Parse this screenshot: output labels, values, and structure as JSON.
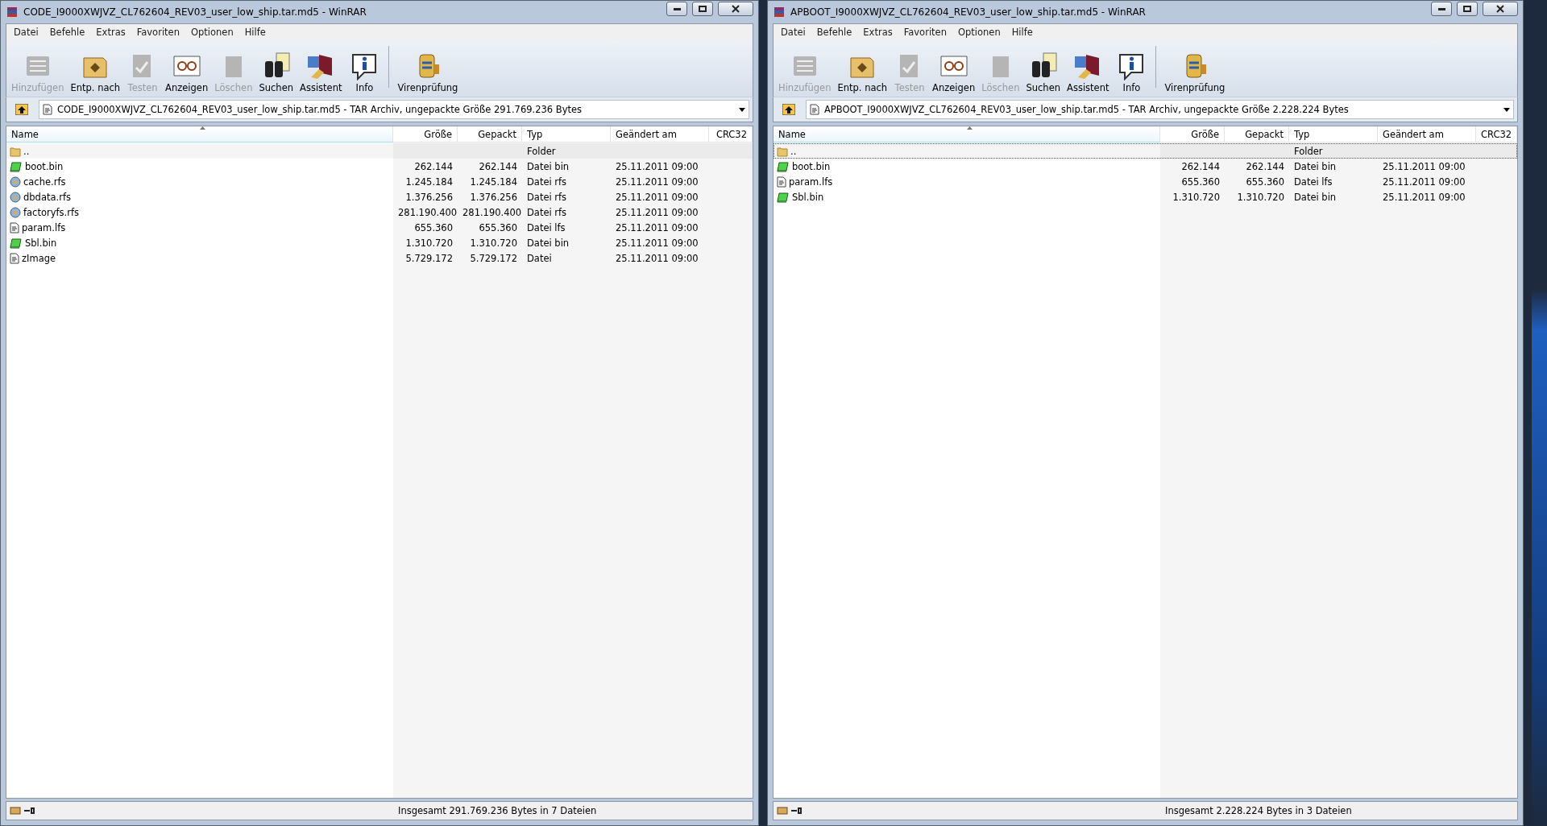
{
  "windows": [
    {
      "title": "CODE_I9000XWJVZ_CL762604_REV03_user_low_ship.tar.md5 - WinRAR",
      "menu": [
        "Datei",
        "Befehle",
        "Extras",
        "Favoriten",
        "Optionen",
        "Hilfe"
      ],
      "toolbar": [
        {
          "label": "Hinzufügen",
          "kind": "add",
          "disabled": true
        },
        {
          "label": "Entp. nach",
          "kind": "extract",
          "disabled": false
        },
        {
          "label": "Testen",
          "kind": "test",
          "disabled": true
        },
        {
          "label": "Anzeigen",
          "kind": "view",
          "disabled": false
        },
        {
          "label": "Löschen",
          "kind": "delete",
          "disabled": true
        },
        {
          "label": "Suchen",
          "kind": "find",
          "disabled": false
        },
        {
          "label": "Assistent",
          "kind": "wizard",
          "disabled": false
        },
        {
          "label": "Info",
          "kind": "info",
          "disabled": false
        },
        {
          "label": "Virenprüfung",
          "kind": "virus",
          "disabled": false
        }
      ],
      "address": "CODE_I9000XWJVZ_CL762604_REV03_user_low_ship.tar.md5 - TAR Archiv, ungepackte Größe 291.769.236 Bytes",
      "columns": [
        "Name",
        "Größe",
        "Gepackt",
        "Typ",
        "Geändert am",
        "CRC32"
      ],
      "rows": [
        {
          "kind": "folder",
          "name": "..",
          "size": "",
          "packed": "",
          "type": "Folder",
          "modified": "",
          "selected": false
        },
        {
          "kind": "binary",
          "name": "boot.bin",
          "size": "262.144",
          "packed": "262.144",
          "type": "Datei bin",
          "modified": "25.11.2011 09:00",
          "selected": false
        },
        {
          "kind": "disc",
          "name": "cache.rfs",
          "size": "1.245.184",
          "packed": "1.245.184",
          "type": "Datei rfs",
          "modified": "25.11.2011 09:00",
          "selected": false
        },
        {
          "kind": "disc",
          "name": "dbdata.rfs",
          "size": "1.376.256",
          "packed": "1.376.256",
          "type": "Datei rfs",
          "modified": "25.11.2011 09:00",
          "selected": false
        },
        {
          "kind": "disc",
          "name": "factoryfs.rfs",
          "size": "281.190.400",
          "packed": "281.190.400",
          "type": "Datei rfs",
          "modified": "25.11.2011 09:00",
          "selected": false
        },
        {
          "kind": "document",
          "name": "param.lfs",
          "size": "655.360",
          "packed": "655.360",
          "type": "Datei lfs",
          "modified": "25.11.2011 09:00",
          "selected": false
        },
        {
          "kind": "binary",
          "name": "Sbl.bin",
          "size": "1.310.720",
          "packed": "1.310.720",
          "type": "Datei bin",
          "modified": "25.11.2011 09:00",
          "selected": false
        },
        {
          "kind": "document",
          "name": "zImage",
          "size": "5.729.172",
          "packed": "5.729.172",
          "type": "Datei",
          "modified": "25.11.2011 09:00",
          "selected": false
        }
      ],
      "status": "Insgesamt 291.769.236 Bytes in 7 Dateien"
    },
    {
      "title": "APBOOT_I9000XWJVZ_CL762604_REV03_user_low_ship.tar.md5 - WinRAR",
      "menu": [
        "Datei",
        "Befehle",
        "Extras",
        "Favoriten",
        "Optionen",
        "Hilfe"
      ],
      "toolbar": [
        {
          "label": "Hinzufügen",
          "kind": "add",
          "disabled": true
        },
        {
          "label": "Entp. nach",
          "kind": "extract",
          "disabled": false
        },
        {
          "label": "Testen",
          "kind": "test",
          "disabled": true
        },
        {
          "label": "Anzeigen",
          "kind": "view",
          "disabled": false
        },
        {
          "label": "Löschen",
          "kind": "delete",
          "disabled": true
        },
        {
          "label": "Suchen",
          "kind": "find",
          "disabled": false
        },
        {
          "label": "Assistent",
          "kind": "wizard",
          "disabled": false
        },
        {
          "label": "Info",
          "kind": "info",
          "disabled": false
        },
        {
          "label": "Virenprüfung",
          "kind": "virus",
          "disabled": false
        }
      ],
      "address": "APBOOT_I9000XWJVZ_CL762604_REV03_user_low_ship.tar.md5 - TAR Archiv, ungepackte Größe 2.228.224 Bytes",
      "columns": [
        "Name",
        "Größe",
        "Gepackt",
        "Typ",
        "Geändert am",
        "CRC32"
      ],
      "rows": [
        {
          "kind": "folder",
          "name": "..",
          "size": "",
          "packed": "",
          "type": "Folder",
          "modified": "",
          "selected": true
        },
        {
          "kind": "binary",
          "name": "boot.bin",
          "size": "262.144",
          "packed": "262.144",
          "type": "Datei bin",
          "modified": "25.11.2011 09:00",
          "selected": false
        },
        {
          "kind": "document",
          "name": "param.lfs",
          "size": "655.360",
          "packed": "655.360",
          "type": "Datei lfs",
          "modified": "25.11.2011 09:00",
          "selected": false
        },
        {
          "kind": "binary",
          "name": "Sbl.bin",
          "size": "1.310.720",
          "packed": "1.310.720",
          "type": "Datei bin",
          "modified": "25.11.2011 09:00",
          "selected": false
        }
      ],
      "status": "Insgesamt 2.228.224 Bytes in 3 Dateien"
    }
  ]
}
